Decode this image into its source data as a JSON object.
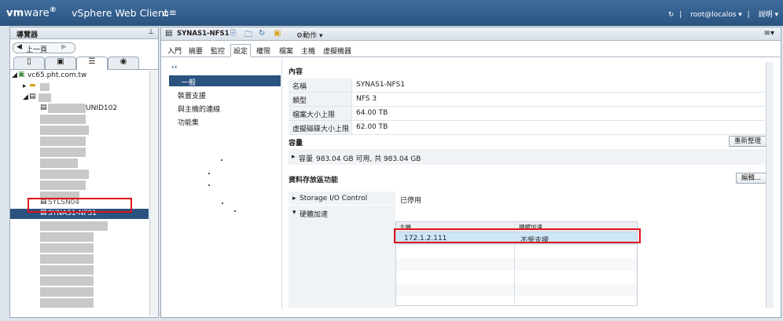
{
  "topbar": {
    "brand_vm": "vm",
    "brand_ware": "ware",
    "app_name": "vSphere Web Client",
    "home_icon": "home-icon",
    "refresh_icon": "refresh-icon",
    "user": "root@localos",
    "help": "說明"
  },
  "navigator": {
    "title": "導覽器",
    "back_label": "上一頁",
    "tabs": [
      "hosts-clusters-icon",
      "vms-templates-icon",
      "storage-icon",
      "networking-icon"
    ],
    "tree": {
      "root": "vc65.pht.com.tw",
      "partial_item_1": "UNID102",
      "partial_item_2": "SYLSN04",
      "selected_item": "SYNAS1-NFS1"
    }
  },
  "main": {
    "object_name": "SYNAS1-NFS1",
    "actions_label": "動作",
    "tabs": [
      "入門",
      "摘要",
      "監控",
      "設定",
      "權限",
      "檔案",
      "主機",
      "虛擬機器"
    ],
    "active_tab": "設定",
    "settings_nav": [
      "一般",
      "裝置支援",
      "與主機的連線",
      "功能集"
    ],
    "properties": {
      "title": "內容",
      "rows": [
        {
          "label": "名稱",
          "value": "SYNAS1-NFS1"
        },
        {
          "label": "類型",
          "value": "NFS 3"
        },
        {
          "label": "檔案大小上限",
          "value": "64.00 TB"
        },
        {
          "label": "虛擬磁碟大小上限",
          "value": "62.00 TB"
        }
      ]
    },
    "capacity": {
      "title": "容量",
      "refresh_button": "重新整理",
      "label": "容量",
      "value": "983.04 GB 可用, 共 983.04 GB"
    },
    "storage_capabilities": {
      "title": "資料存放區功能",
      "edit_button": "編輯...",
      "storage_io_label": "Storage I/O Control",
      "storage_io_value": "已停用",
      "hw_accel_label": "硬體加速",
      "grid": {
        "col_host": "主機",
        "col_hw_accel": "硬體加速",
        "rows": [
          {
            "host": "172.1.2.111",
            "status": "不受支援"
          }
        ]
      }
    }
  }
}
